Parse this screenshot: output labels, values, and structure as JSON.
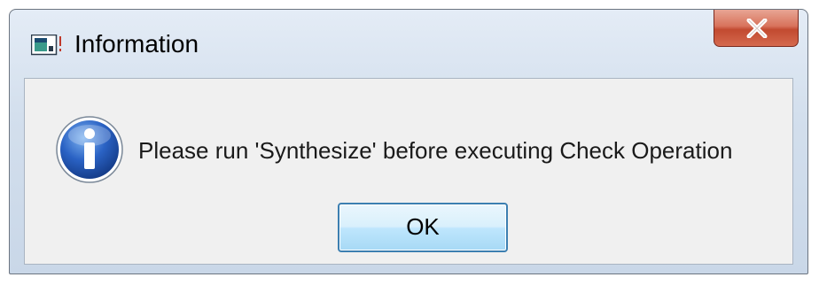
{
  "dialog": {
    "title": "Information",
    "message": "Please run 'Synthesize' before executing Check Operation",
    "ok_label": "OK",
    "icons": {
      "app": "application-icon",
      "close": "close-icon",
      "info": "information-icon"
    }
  },
  "colors": {
    "titlebar": "#d3dfed",
    "close_button": "#c24a30",
    "client_background": "#f0f0f0",
    "info_icon": "#1f4fa8",
    "ok_border": "#3c7fb1"
  }
}
